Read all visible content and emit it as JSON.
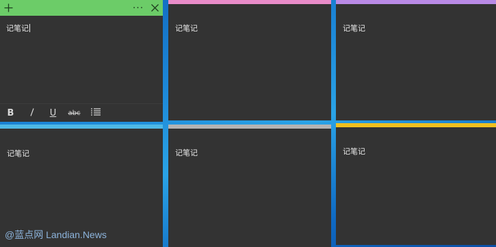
{
  "notes": [
    {
      "text": "记笔记",
      "color": "#6ccc68",
      "active": true
    },
    {
      "text": "记笔记",
      "color": "#e98cc9"
    },
    {
      "text": "记笔记",
      "color": "#b98ae6"
    },
    {
      "text": "记笔记",
      "color": "#4fb8e5"
    },
    {
      "text": "记笔记",
      "color": "#b3b3b3"
    },
    {
      "text": "记笔记",
      "color": "#f0c01e"
    }
  ],
  "header": {
    "add_icon": "plus-icon",
    "more_icon": "ellipsis-icon",
    "close_icon": "close-icon"
  },
  "toolbar": {
    "bold": "B",
    "italic": "I",
    "underline": "U",
    "strikethrough": "abc",
    "list_icon": "bulleted-list-icon"
  },
  "watermark": "@蓝点网 Landian.News"
}
